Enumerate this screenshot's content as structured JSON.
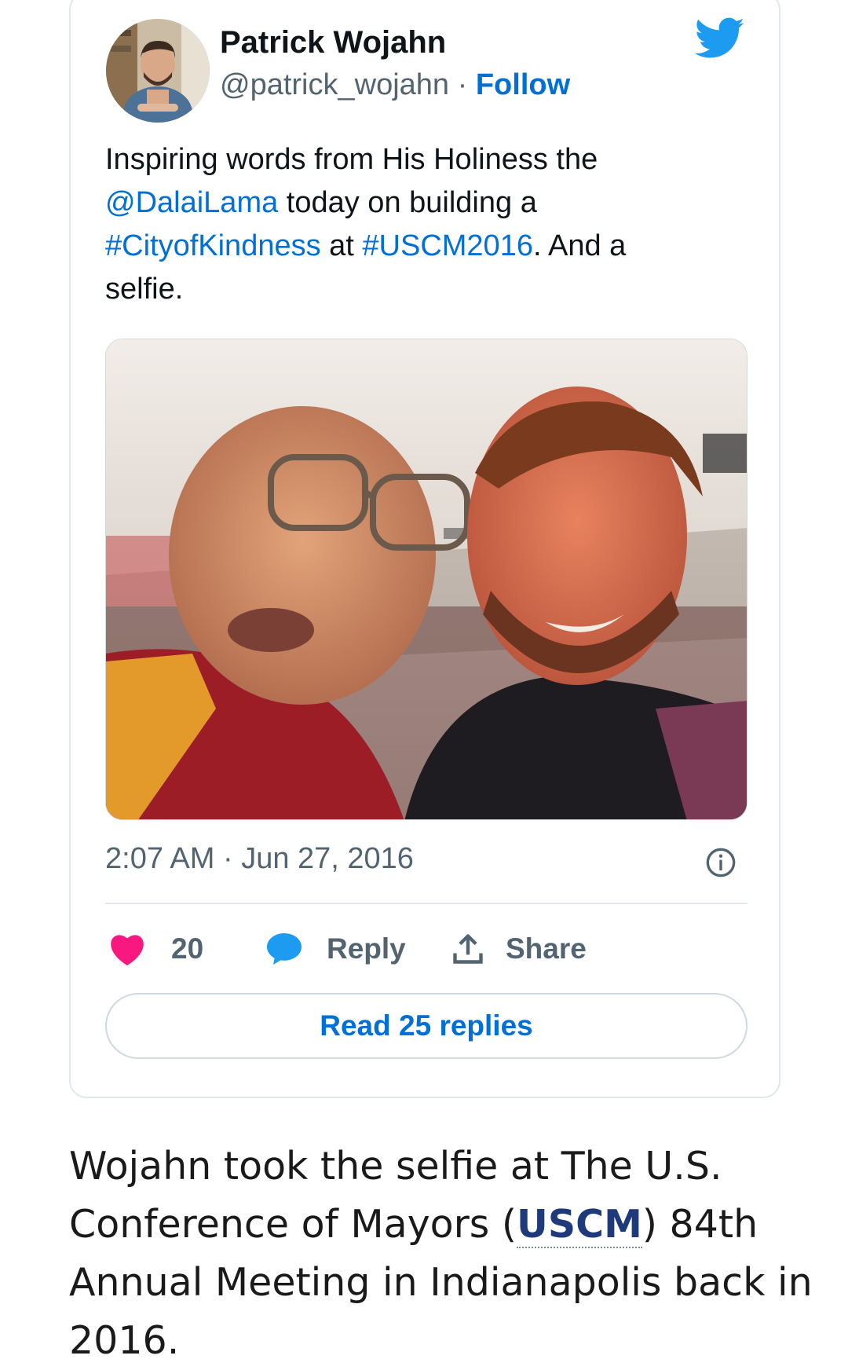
{
  "tweet": {
    "author_name": "Patrick Wojahn",
    "handle": "@patrick_wojahn",
    "separator": " · ",
    "follow_label": "Follow",
    "text": {
      "p1": "Inspiring words from His Holiness the ",
      "mention": "@DalaiLama",
      "p2": " today on building a ",
      "hashtag1": "#CityofKindness",
      "p3": " at ",
      "hashtag2": "#USCM2016",
      "p4": ". And a selfie."
    },
    "timestamp": "2:07 AM · Jun 27, 2016",
    "like_count": "20",
    "reply_label": "Reply",
    "share_label": "Share",
    "read_replies_label": "Read 25 replies",
    "colors": {
      "link": "#006fd6",
      "like": "#f91880",
      "twitter_blue": "#1d9bf0"
    },
    "icons": [
      "avatar-photo",
      "twitter-bird-icon",
      "info-icon",
      "heart-icon",
      "speech-bubble-icon",
      "share-upload-icon"
    ]
  },
  "article": {
    "caption_part1": "Wojahn took the selfie at The U.S. Conference of Mayors ",
    "abbr_open": "(",
    "abbr": "USCM",
    "abbr_close": ")",
    "caption_part2": " 84th Annual Meeting in Indianapolis back in 2016."
  }
}
